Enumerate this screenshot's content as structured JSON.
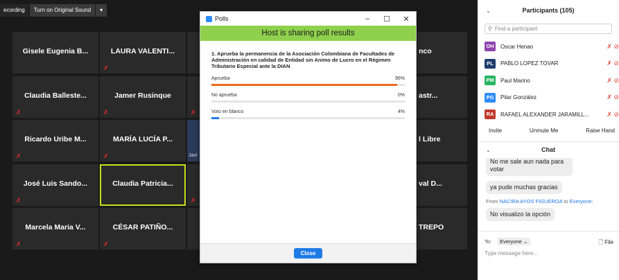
{
  "toolbar": {
    "recording": "ecording",
    "sound": "Turn on Original Sound",
    "caret": "▾"
  },
  "tiles": [
    "Gisele Eugenia B...",
    "LAURA VALENTI...",
    "Claudia Balleste...",
    "Jamer Rusinque",
    "Ricardo Uribe M...",
    "MARÍA LUCÍA P...",
    "José Luis Sando...",
    "Claudia Patricia...",
    "Marcela Maria V...",
    "CÉSAR PATIÑO..."
  ],
  "right_tiles": [
    "nco",
    "astr...",
    "l Libre",
    "val D...",
    "TREPO"
  ],
  "side_label": "Javi",
  "polls": {
    "title": "Polls",
    "banner": "Host is sharing poll results",
    "question": "1. Aprueba la permanencia de la Asociación Colombiana de Facultades de Administración en calidad de Entidad sin Animo de Lucro en el Régimen Tributario Especial ante la DIAN",
    "options": [
      {
        "label": "Aprueba",
        "pct": "96%",
        "value": 0.96,
        "color": "#ee6a1f"
      },
      {
        "label": "No aprueba",
        "pct": "0%",
        "value": 0.0,
        "color": "#1f7be6"
      },
      {
        "label": "Voto en blanco",
        "pct": "4%",
        "value": 0.04,
        "color": "#1f7be6"
      }
    ],
    "close": "Close",
    "min": "–",
    "max": "☐",
    "x": "✕"
  },
  "participants": {
    "title": "Participants (105)",
    "search_placeholder": "Find a participant",
    "items": [
      {
        "initials": "OH",
        "name": "Oscar Henao",
        "color": "#8e44ad"
      },
      {
        "initials": "PL",
        "name": "PABLO LOPEZ TOVAR",
        "color": "#1f3d6e"
      },
      {
        "initials": "PM",
        "name": "Paul Marino",
        "color": "#28b463"
      },
      {
        "initials": "PG",
        "name": "Pilar González",
        "color": "#2d8cff"
      },
      {
        "initials": "RA",
        "name": "RAFAEL ALEXANDER JARAMILL...",
        "color": "#c0392b"
      }
    ],
    "invite": "Invite",
    "unmute": "Unmute Me",
    "raise": "Raise Hand"
  },
  "chat": {
    "title": "Chat",
    "msg0": "No me sale aun nada para votar",
    "msg1": "ya pude muchas gracias",
    "from_prefix": "From",
    "from_name": "NACIRA AYOS FIGUEROA",
    "to_word": "to",
    "to_target": "Everyone:",
    "msg2": "No visualizo la opción",
    "to_label": "To:",
    "to_value": "Everyone ⌄",
    "file": "File",
    "input_placeholder": "Type message here..."
  }
}
